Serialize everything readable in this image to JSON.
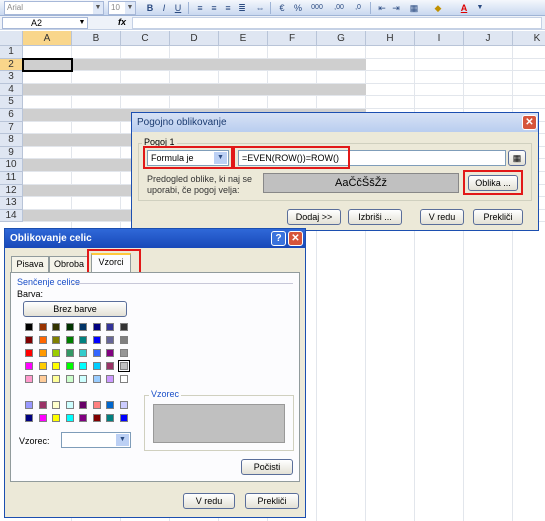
{
  "toolbar": {
    "font_name": "Arial",
    "font_size": "10",
    "bold_label": "B",
    "italic_label": "I",
    "underline_label": "U",
    "percent_label": "%",
    "thousands_label": "000",
    "decimals_more_label": ",00",
    "decimals_less_label": ",0",
    "font_color_label": "A"
  },
  "formula_bar": {
    "cell_ref": "A2",
    "fx_label": "fx",
    "formula": ""
  },
  "sheet": {
    "columns": [
      "A",
      "B",
      "C",
      "D",
      "E",
      "F",
      "G",
      "H",
      "I",
      "J",
      "K"
    ],
    "rows": [
      "1",
      "2",
      "3",
      "4",
      "5",
      "6",
      "7",
      "8",
      "9",
      "10",
      "11",
      "12",
      "13",
      "14"
    ],
    "selected_column": "A",
    "selected_row": "2",
    "shade_color": "#cfcfcf"
  },
  "cond_dialog": {
    "title": "Pogojno oblikovanje",
    "group_label": "Pogoj 1",
    "condition_type": "Formula je",
    "formula": "=EVEN(ROW())=ROW()",
    "preview_label": "Predogled oblike, ki naj se uporabi, če pogoj velja:",
    "preview_text": "AaČčŠšŽž",
    "format_button": "Oblika ...",
    "add_button": "Dodaj >>",
    "delete_button": "Izbriši ...",
    "ok_button": "V redu",
    "cancel_button": "Prekliči"
  },
  "format_dialog": {
    "title": "Oblikovanje celic",
    "help_label": "?",
    "tabs": [
      {
        "label": "Pisava"
      },
      {
        "label": "Obroba"
      },
      {
        "label": "Vzorci"
      }
    ],
    "active_tab": "Vzorci",
    "shading_group": "Senčenje celice",
    "color_label": "Barva:",
    "no_color_button": "Brez barve",
    "sample_group": "Vzorec",
    "pattern_label": "Vzorec:",
    "clear_button": "Počisti",
    "ok_button": "V redu",
    "cancel_button": "Prekliči",
    "sample_color": "#c0c0c0",
    "palette": [
      [
        "#000000",
        "#993300",
        "#333300",
        "#003300",
        "#003366",
        "#000080",
        "#333399",
        "#333333"
      ],
      [
        "#800000",
        "#ff6600",
        "#808000",
        "#008000",
        "#008080",
        "#0000ff",
        "#666699",
        "#808080"
      ],
      [
        "#ff0000",
        "#ff9900",
        "#99cc00",
        "#339966",
        "#33cccc",
        "#3366ff",
        "#800080",
        "#969696"
      ],
      [
        "#ff00ff",
        "#ffcc00",
        "#ffff00",
        "#00ff00",
        "#00ffff",
        "#00ccff",
        "#993366",
        "#c0c0c0"
      ],
      [
        "#ff99cc",
        "#ffcc99",
        "#ffff99",
        "#ccffcc",
        "#ccffff",
        "#99ccff",
        "#cc99ff",
        "#ffffff"
      ]
    ],
    "palette_extra": [
      [
        "#9999ff",
        "#993366",
        "#ffffcc",
        "#ccffff",
        "#660066",
        "#ff8080",
        "#0066cc",
        "#ccccff"
      ],
      [
        "#000080",
        "#ff00ff",
        "#ffff00",
        "#00ffff",
        "#800080",
        "#800000",
        "#008080",
        "#0000ff"
      ]
    ],
    "selected_color": "#c0c0c0"
  }
}
